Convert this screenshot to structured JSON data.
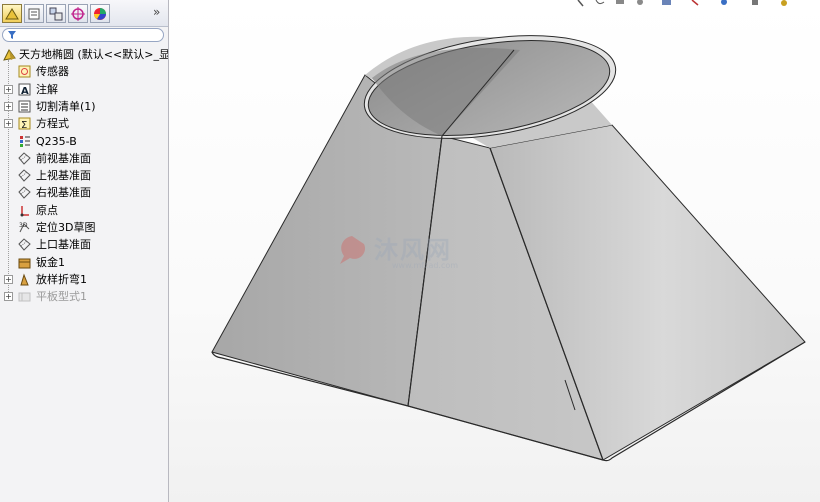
{
  "tabs": [
    {
      "name": "featuremanager",
      "icon": "featuremanager-icon",
      "active": true
    },
    {
      "name": "propertymanager",
      "icon": "propertymanager-icon",
      "active": false
    },
    {
      "name": "configurationmanager",
      "icon": "configurationmanager-icon",
      "active": false
    },
    {
      "name": "dimxpert",
      "icon": "dimxpert-icon",
      "active": false
    },
    {
      "name": "displaymanager",
      "icon": "displaymanager-icon",
      "active": false
    }
  ],
  "expand_label": "»",
  "tree": {
    "root_label": "天方地椭圆 (默认<<默认>_显示",
    "items": [
      {
        "label": "传感器",
        "icon": "sensor-icon",
        "expandable": false,
        "disabled": false
      },
      {
        "label": "注解",
        "icon": "annotation-icon",
        "expandable": true,
        "disabled": false
      },
      {
        "label": "切割清单(1)",
        "icon": "cutlist-icon",
        "expandable": true,
        "disabled": false
      },
      {
        "label": "方程式",
        "icon": "equation-icon",
        "expandable": true,
        "disabled": false
      },
      {
        "label": "Q235-B",
        "icon": "material-icon",
        "expandable": false,
        "disabled": false
      },
      {
        "label": "前视基准面",
        "icon": "plane-icon",
        "expandable": false,
        "disabled": false
      },
      {
        "label": "上视基准面",
        "icon": "plane-icon",
        "expandable": false,
        "disabled": false
      },
      {
        "label": "右视基准面",
        "icon": "plane-icon",
        "expandable": false,
        "disabled": false
      },
      {
        "label": "原点",
        "icon": "origin-icon",
        "expandable": false,
        "disabled": false
      },
      {
        "label": "定位3D草图",
        "icon": "sketch3d-icon",
        "expandable": false,
        "disabled": false
      },
      {
        "label": "上口基准面",
        "icon": "plane-icon",
        "expandable": false,
        "disabled": false
      },
      {
        "label": "钣金1",
        "icon": "sheetmetal-icon",
        "expandable": false,
        "disabled": false
      },
      {
        "label": "放样折弯1",
        "icon": "loftedbend-icon",
        "expandable": true,
        "disabled": false
      },
      {
        "label": "平板型式1",
        "icon": "flatpattern-icon",
        "expandable": true,
        "disabled": true
      }
    ]
  },
  "watermark": {
    "text": "沐风网",
    "url": "www.mfcad.com"
  },
  "colors": {
    "panel_bg": "#f3f3f5",
    "model_light": "#d6d6d6",
    "model_dark": "#a9a9a9",
    "edge": "#2a2a2a"
  }
}
